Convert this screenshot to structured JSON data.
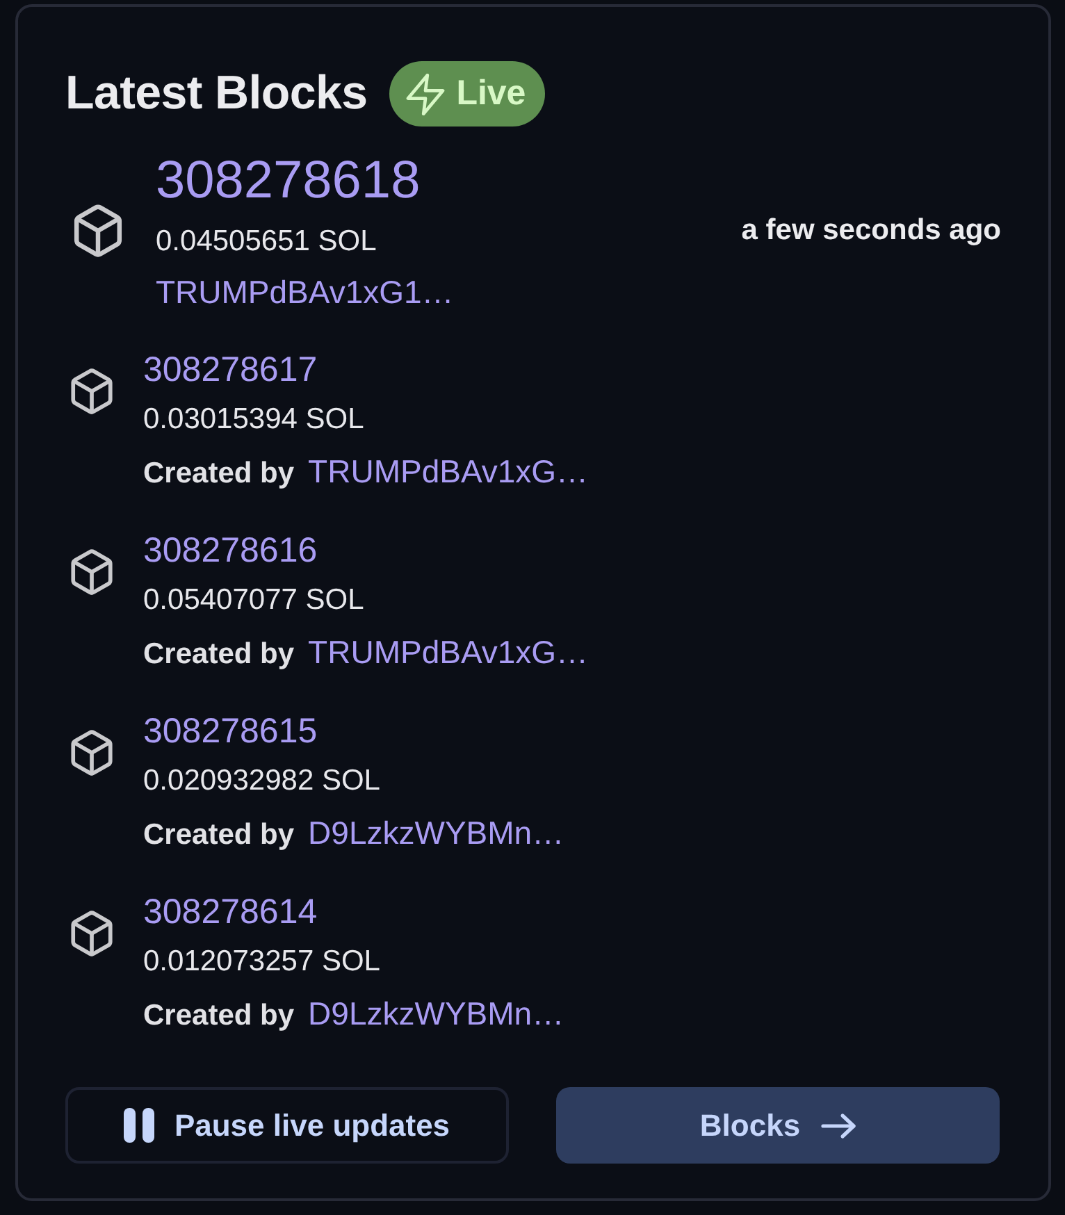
{
  "title": "Latest Blocks",
  "badge": {
    "label": "Live"
  },
  "blocks": [
    {
      "kind": "featured",
      "number": "308278618",
      "reward": "0.04505651 SOL",
      "creator": "TRUMPdBAv1xG1…",
      "time": "a few seconds ago"
    },
    {
      "kind": "compact",
      "number": "308278617",
      "reward": "0.03015394 SOL",
      "creator_label": "Created by",
      "creator": "TRUMPdBAv1xG…"
    },
    {
      "kind": "compact",
      "number": "308278616",
      "reward": "0.05407077 SOL",
      "creator_label": "Created by",
      "creator": "TRUMPdBAv1xG…"
    },
    {
      "kind": "compact",
      "number": "308278615",
      "reward": "0.020932982 SOL",
      "creator_label": "Created by",
      "creator": "D9LzkzWYBMn…"
    },
    {
      "kind": "compact",
      "number": "308278614",
      "reward": "0.012073257 SOL",
      "creator_label": "Created by",
      "creator": "D9LzkzWYBMn…"
    }
  ],
  "buttons": [
    {
      "kind": "pause",
      "label": "Pause live updates"
    },
    {
      "kind": "link",
      "label": "Blocks"
    }
  ]
}
